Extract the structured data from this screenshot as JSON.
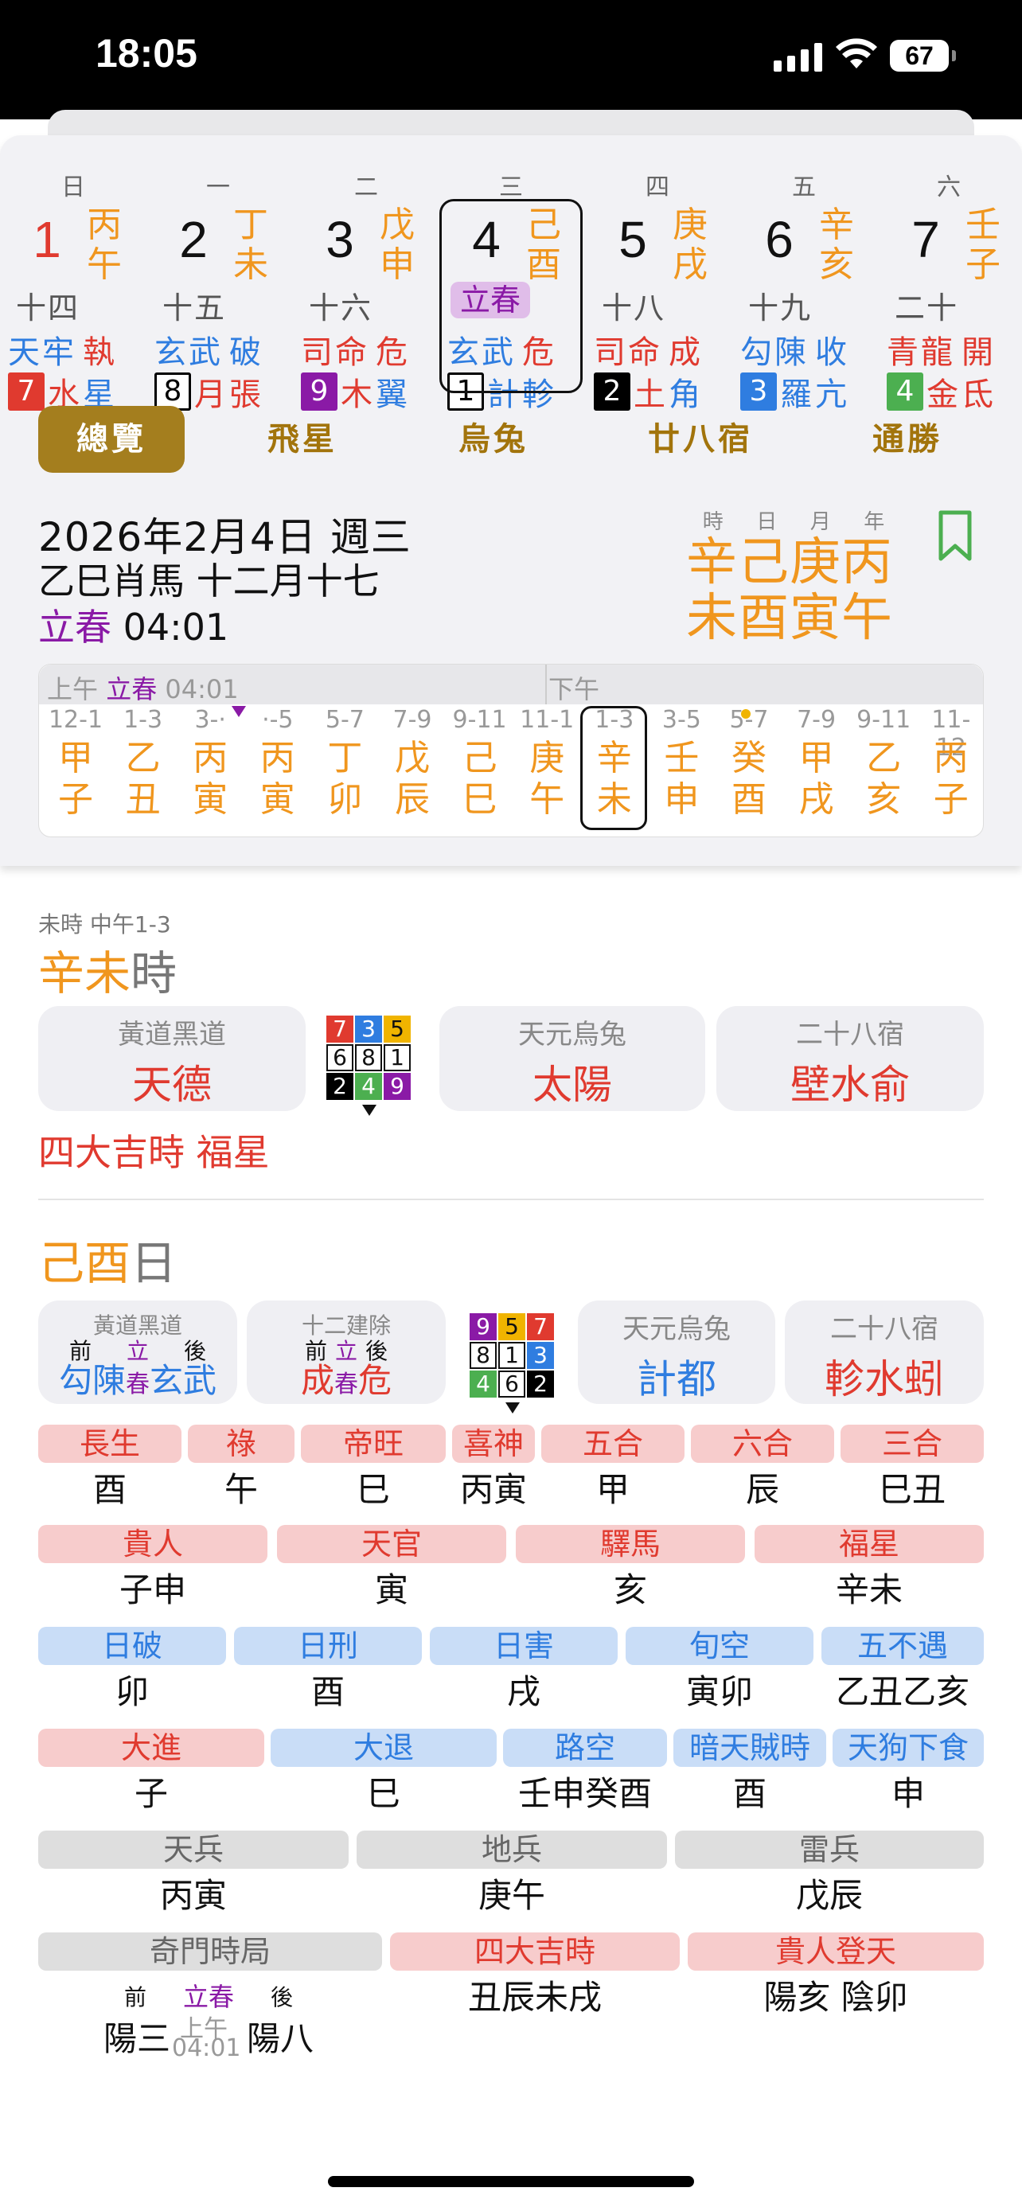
{
  "status": {
    "time": "18:05",
    "battery": "67"
  },
  "colors": {
    "gold": "#f0961e",
    "red": "#e03a2f",
    "blue": "#2f7de0",
    "purple": "#8a1aa6"
  },
  "week": {
    "weekdays": [
      "日",
      "一",
      "二",
      "三",
      "四",
      "五",
      "六"
    ],
    "days": [
      {
        "num": "1",
        "gz1": "丙",
        "gz2": "午",
        "lunar": "十四",
        "god": "天牢",
        "act": "執",
        "box": "7",
        "boxc": "#e03a2f",
        "star": "水",
        "mansion": "星",
        "numc": "#e03a2f",
        "godc": "#2f7de0",
        "actc": "#e03a2f"
      },
      {
        "num": "2",
        "gz1": "丁",
        "gz2": "未",
        "lunar": "十五",
        "god": "玄武",
        "act": "破",
        "box": "8",
        "boxc": "#fff",
        "star": "月",
        "mansion": "張",
        "numc": "#111",
        "godc": "#2f7de0",
        "actc": "#2f7de0"
      },
      {
        "num": "3",
        "gz1": "戊",
        "gz2": "申",
        "lunar": "十六",
        "god": "司命",
        "act": "危",
        "box": "9",
        "boxc": "#8a1aa6",
        "star": "木",
        "mansion": "翼",
        "numc": "#111",
        "godc": "#e03a2f",
        "actc": "#e03a2f"
      },
      {
        "num": "4",
        "gz1": "己",
        "gz2": "酉",
        "lunar": "立春",
        "god": "玄武",
        "act": "危",
        "box": "1",
        "boxc": "#fff",
        "star": "計",
        "mansion": "軫",
        "numc": "#111",
        "godc": "#2f7de0",
        "actc": "#e03a2f"
      },
      {
        "num": "5",
        "gz1": "庚",
        "gz2": "戌",
        "lunar": "十八",
        "god": "司命",
        "act": "成",
        "box": "2",
        "boxc": "#000",
        "star": "土",
        "mansion": "角",
        "numc": "#111",
        "godc": "#e03a2f",
        "actc": "#e03a2f"
      },
      {
        "num": "6",
        "gz1": "辛",
        "gz2": "亥",
        "lunar": "十九",
        "god": "勾陳",
        "act": "收",
        "box": "3",
        "boxc": "#2f7de0",
        "star": "羅",
        "mansion": "亢",
        "numc": "#111",
        "godc": "#2f7de0",
        "actc": "#2f7de0"
      },
      {
        "num": "7",
        "gz1": "壬",
        "gz2": "子",
        "lunar": "二十",
        "god": "青龍",
        "act": "開",
        "box": "4",
        "boxc": "#4caf50",
        "star": "金",
        "mansion": "氐",
        "numc": "#111",
        "godc": "#e03a2f",
        "actc": "#e03a2f"
      }
    ]
  },
  "tabs": [
    "總覽",
    "飛星",
    "烏兔",
    "廿八宿",
    "通勝"
  ],
  "date": {
    "line1": "2026年2月4日 週三",
    "line2": "乙巳肖馬 十二月十七",
    "term": "立春",
    "term_time": "04:01"
  },
  "pillars": {
    "heads": [
      "時",
      "日",
      "月",
      "年"
    ],
    "top": "辛己庚丙",
    "bottom": "未酉寅午"
  },
  "hours": {
    "am_label": "上午",
    "am_term": "立春",
    "am_time": "04:01",
    "pm_label": "下午",
    "cols": [
      {
        "r": "12-1",
        "g1": "甲",
        "g2": "子"
      },
      {
        "r": "1-3",
        "g1": "乙",
        "g2": "丑"
      },
      {
        "r": "3-·",
        "g1": "丙",
        "g2": "寅"
      },
      {
        "r": "·-5",
        "g1": "丙",
        "g2": "寅"
      },
      {
        "r": "5-7",
        "g1": "丁",
        "g2": "卯"
      },
      {
        "r": "7-9",
        "g1": "戊",
        "g2": "辰"
      },
      {
        "r": "9-11",
        "g1": "己",
        "g2": "巳"
      },
      {
        "r": "11-1",
        "g1": "庚",
        "g2": "午"
      },
      {
        "r": "1-3",
        "g1": "辛",
        "g2": "未"
      },
      {
        "r": "3-5",
        "g1": "壬",
        "g2": "申"
      },
      {
        "r": "5-7",
        "g1": "癸",
        "g2": "酉"
      },
      {
        "r": "7-9",
        "g1": "甲",
        "g2": "戌"
      },
      {
        "r": "9-11",
        "g1": "乙",
        "g2": "亥"
      },
      {
        "r": "11-12",
        "g1": "丙",
        "g2": "子"
      }
    ]
  },
  "hour_sec": {
    "sub": "未時 中午1-3",
    "title_gz": "辛未",
    "title_suffix": "時",
    "card1_t": "黃道黑道",
    "card1_v": "天德",
    "card2_t": "天元烏兔",
    "card2_v": "太陽",
    "card3_t": "二十八宿",
    "card3_v": "壁水俞",
    "grid": [
      "7",
      "3",
      "5",
      "6",
      "8",
      "1",
      "2",
      "4",
      "9"
    ],
    "note": "四大吉時 福星"
  },
  "day_sec": {
    "title_gz": "己酉",
    "title_suffix": "日",
    "c1_t": "黃道黑道",
    "c1_before": "前",
    "c1_mid": "立",
    "c1_after": "後",
    "c1_v1": "勾陳",
    "c1_v2": "春",
    "c1_v3": "玄武",
    "c2_t": "十二建除",
    "c2_before": "前",
    "c2_mid": "立",
    "c2_after": "後",
    "c2_v1": "成",
    "c2_v2": "春",
    "c2_v3": "危",
    "c3_t": "天元烏兔",
    "c3_v": "計都",
    "c4_t": "二十八宿",
    "c4_v": "軫水蚓",
    "grid": [
      "9",
      "5",
      "7",
      "8",
      "1",
      "3",
      "4",
      "6",
      "2"
    ]
  },
  "rows": {
    "r1": [
      {
        "t": "長生",
        "v": "酉"
      },
      {
        "t": "祿",
        "v": "午"
      },
      {
        "t": "帝旺",
        "v": "巳"
      },
      {
        "t": "喜神",
        "v": "丙寅"
      },
      {
        "t": "五合",
        "v": "甲"
      },
      {
        "t": "六合",
        "v": "辰"
      },
      {
        "t": "三合",
        "v": "巳丑"
      }
    ],
    "r2": [
      {
        "t": "貴人",
        "v": "子申"
      },
      {
        "t": "天官",
        "v": "寅"
      },
      {
        "t": "驛馬",
        "v": "亥"
      },
      {
        "t": "福星",
        "v": "辛未"
      }
    ],
    "r3": [
      {
        "t": "日破",
        "v": "卯"
      },
      {
        "t": "日刑",
        "v": "酉"
      },
      {
        "t": "日害",
        "v": "戌"
      },
      {
        "t": "旬空",
        "v": "寅卯"
      },
      {
        "t": "五不遇",
        "v": "乙丑乙亥"
      }
    ],
    "r4": [
      {
        "t": "大進",
        "v": "子"
      },
      {
        "t": "大退",
        "v": "巳"
      },
      {
        "t": "路空",
        "v": "壬申癸酉"
      },
      {
        "t": "暗天賊時",
        "v": "酉"
      },
      {
        "t": "天狗下食",
        "v": "申"
      }
    ],
    "r5": [
      {
        "t": "天兵",
        "v": "丙寅"
      },
      {
        "t": "地兵",
        "v": "庚午"
      },
      {
        "t": "雷兵",
        "v": "戊辰"
      }
    ],
    "r6": [
      {
        "t": "奇門時局",
        "v": ""
      },
      {
        "t": "四大吉時",
        "v": "丑辰未戌"
      },
      {
        "t": "貴人登天",
        "v": "陽亥 陰卯"
      }
    ]
  },
  "qimen": {
    "before": "前",
    "term": "立春",
    "after": "後",
    "v1": "陽三",
    "ampm": "上午",
    "time": "04:01",
    "v2": "陽八"
  }
}
